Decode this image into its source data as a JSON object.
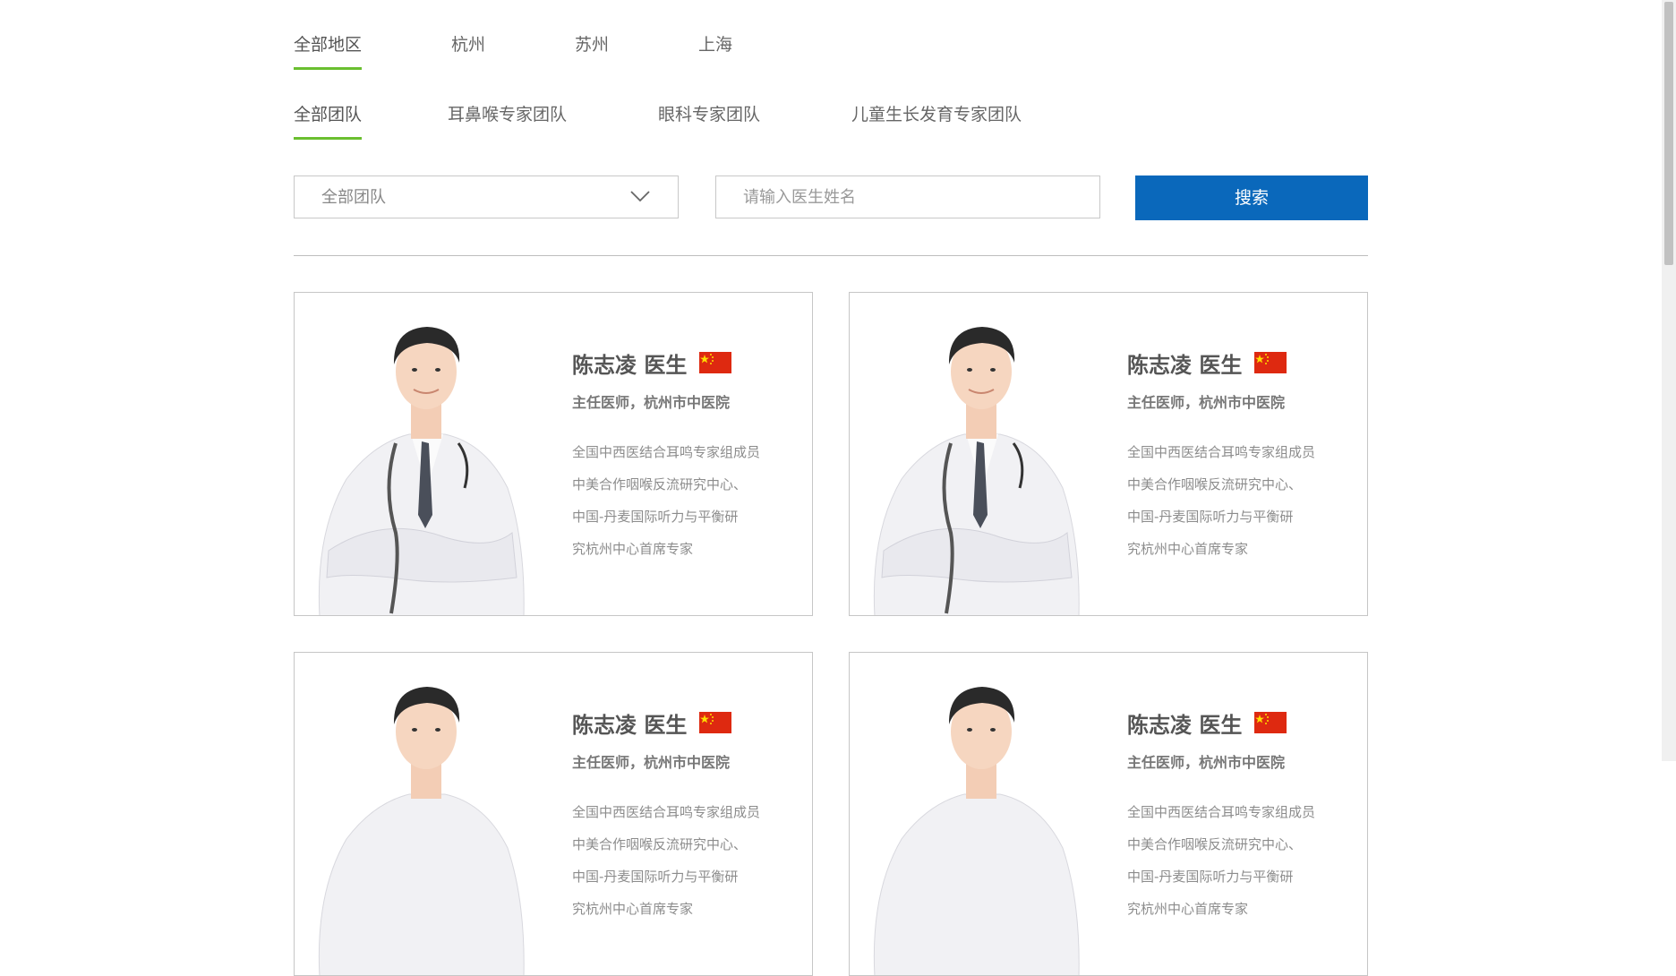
{
  "region_tabs": [
    {
      "label": "全部地区",
      "active": true
    },
    {
      "label": "杭州",
      "active": false
    },
    {
      "label": "苏州",
      "active": false
    },
    {
      "label": "上海",
      "active": false
    }
  ],
  "team_tabs": [
    {
      "label": "全部团队",
      "active": true
    },
    {
      "label": "耳鼻喉专家团队",
      "active": false
    },
    {
      "label": "眼科专家团队",
      "active": false
    },
    {
      "label": "儿童生长发育专家团队",
      "active": false
    }
  ],
  "filters": {
    "team_select_value": "全部团队",
    "doctor_name_placeholder": "请输入医生姓名",
    "search_label": "搜索"
  },
  "doctors": [
    {
      "name": "陈志凌 医生",
      "title": "主任医师，杭州市中医院",
      "desc": [
        "全国中西医结合耳鸣专家组成员",
        "中美合作咽喉反流研究中心、",
        "中国-丹麦国际听力与平衡研",
        "究杭州中心首席专家"
      ]
    },
    {
      "name": "陈志凌 医生",
      "title": "主任医师，杭州市中医院",
      "desc": [
        "全国中西医结合耳鸣专家组成员",
        "中美合作咽喉反流研究中心、",
        "中国-丹麦国际听力与平衡研",
        "究杭州中心首席专家"
      ]
    },
    {
      "name": "陈志凌 医生",
      "title": "主任医师，杭州市中医院",
      "desc": [
        "全国中西医结合耳鸣专家组成员",
        "中美合作咽喉反流研究中心、",
        "中国-丹麦国际听力与平衡研",
        "究杭州中心首席专家"
      ]
    },
    {
      "name": "陈志凌 医生",
      "title": "主任医师，杭州市中医院",
      "desc": [
        "全国中西医结合耳鸣专家组成员",
        "中美合作咽喉反流研究中心、",
        "中国-丹麦国际听力与平衡研",
        "究杭州中心首席专家"
      ]
    }
  ],
  "colors": {
    "accent_underline": "#6abf2f",
    "search_button": "#0a68bb",
    "flag_red": "#de2910",
    "flag_star": "#ffde00"
  }
}
